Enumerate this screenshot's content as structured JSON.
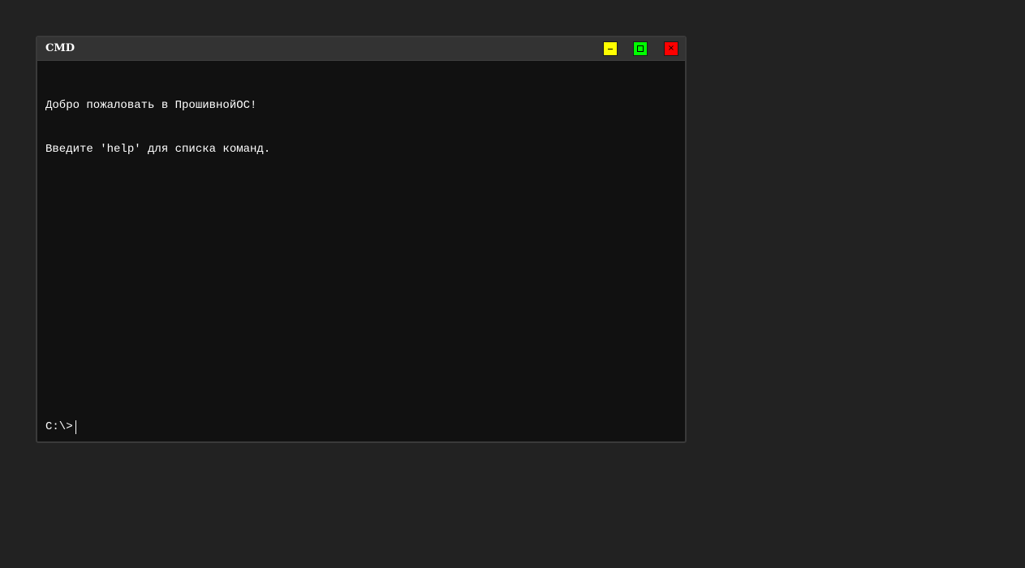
{
  "window": {
    "title": "CMD",
    "buttons": {
      "minimize": {
        "icon": "minimize-icon",
        "color": "#ffff00"
      },
      "maximize": {
        "icon": "maximize-icon",
        "color": "#00ff00"
      },
      "close": {
        "icon": "close-icon",
        "glyph": "×",
        "color": "#ff0000"
      }
    }
  },
  "console": {
    "lines": [
      "Добро пожаловать в ПрошивнойОС!",
      "Введите 'help' для списка команд."
    ],
    "prompt": "C:\\>",
    "input_value": ""
  }
}
